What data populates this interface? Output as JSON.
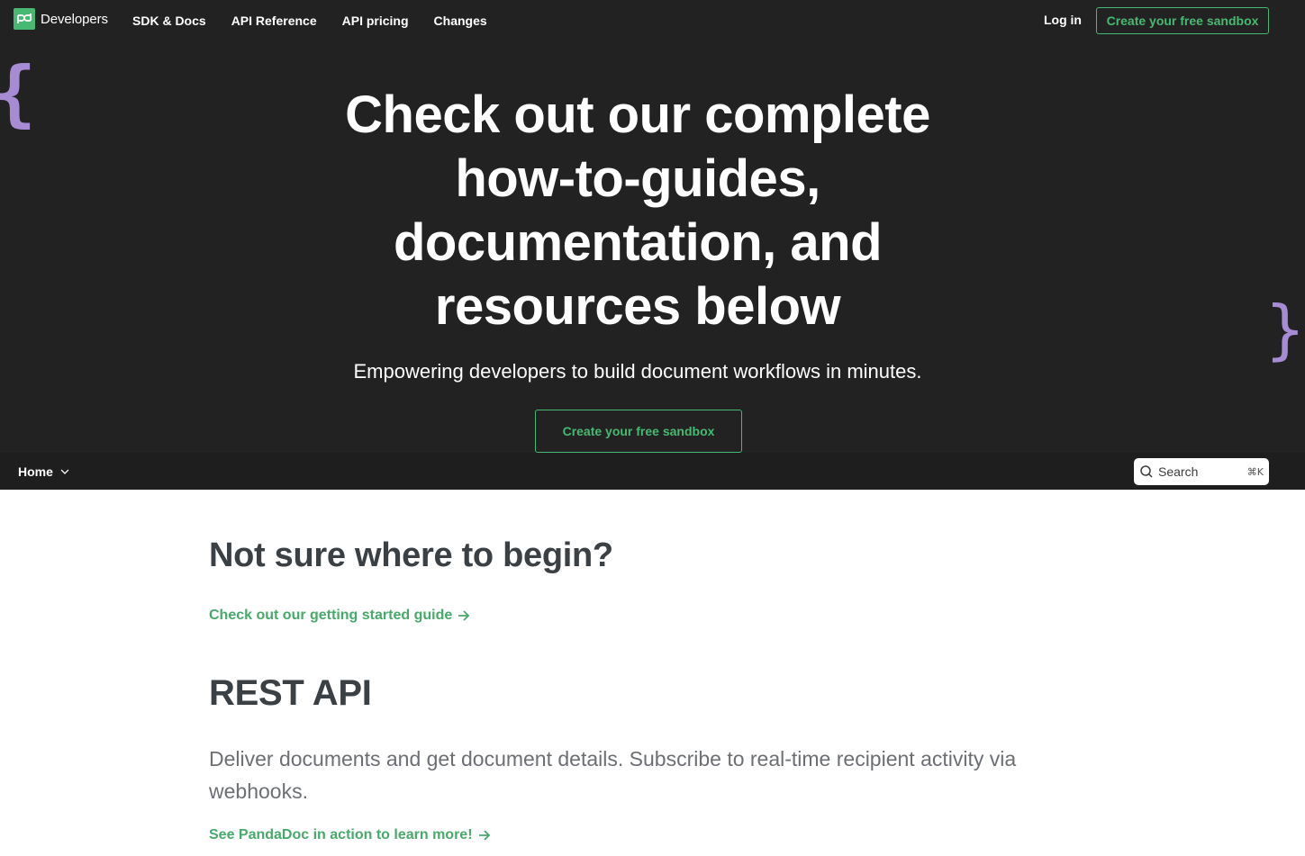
{
  "colors": {
    "dark_bg": "#222222",
    "accent_green": "#47b972",
    "brace_purple": "#a78bd4",
    "heading": "#3b4045",
    "body_text": "#6c6f73"
  },
  "topnav": {
    "logo_icon": "pandadoc-logo-icon",
    "logo_text": "Developers",
    "links": [
      "SDK & Docs",
      "API Reference",
      "API pricing",
      "Changes"
    ],
    "login": "Log in",
    "cta": "Create your free sandbox"
  },
  "hero": {
    "title": "Check out our complete how-to-guides, documentation, and resources below",
    "subtitle": "Empowering developers to build document workflows in minutes.",
    "cta": "Create your free sandbox",
    "brace_left": "{",
    "brace_right": "}"
  },
  "subnav": {
    "home": "Home",
    "search_placeholder": "Search",
    "search_shortcut": "⌘K"
  },
  "content": {
    "begin_heading": "Not sure where to begin?",
    "guide_link": "Check out our getting started guide",
    "rest_heading": "REST API",
    "rest_desc": "Deliver documents and get document details. Subscribe to real-time recipient activity via webhooks.",
    "action_link": "See PandaDoc in action to learn more!"
  }
}
